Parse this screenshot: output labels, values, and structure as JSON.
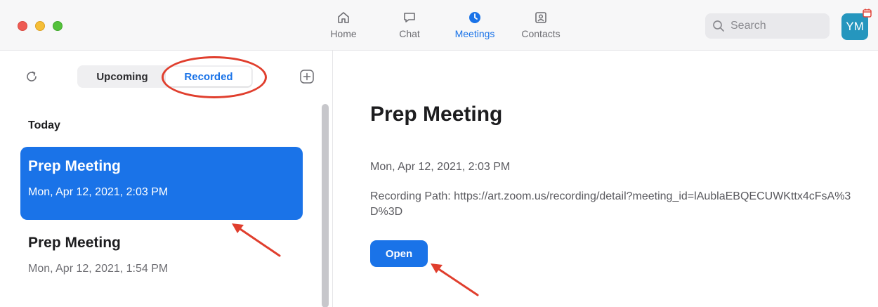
{
  "nav": {
    "tabs": [
      {
        "label": "Home",
        "icon": "home-icon",
        "active": false
      },
      {
        "label": "Chat",
        "icon": "chat-icon",
        "active": false
      },
      {
        "label": "Meetings",
        "icon": "meetings-clock-icon",
        "active": true
      },
      {
        "label": "Contacts",
        "icon": "contacts-icon",
        "active": false
      }
    ]
  },
  "search": {
    "placeholder": "Search"
  },
  "avatar": {
    "initials": "YM",
    "color": "#2596be"
  },
  "sidebar": {
    "segments": {
      "upcoming": "Upcoming",
      "recorded": "Recorded"
    },
    "section_label": "Today",
    "items": [
      {
        "title": "Prep Meeting",
        "date": "Mon, Apr 12, 2021, 2:03 PM",
        "selected": true
      },
      {
        "title": "Prep Meeting",
        "date": "Mon, Apr 12, 2021, 1:54 PM",
        "selected": false
      }
    ]
  },
  "detail": {
    "title": "Prep Meeting",
    "date": "Mon, Apr 12, 2021, 2:03 PM",
    "recording_path": "Recording Path: https://art.zoom.us/recording/detail?meeting_id=lAublaEBQECUWKttx4cFsA%3D%3D",
    "open_label": "Open"
  },
  "colors": {
    "accent": "#1a73e8",
    "annotation": "#e03e2d",
    "close": "#ee5b54",
    "minimize": "#f5be37",
    "zoom": "#54c13b"
  }
}
